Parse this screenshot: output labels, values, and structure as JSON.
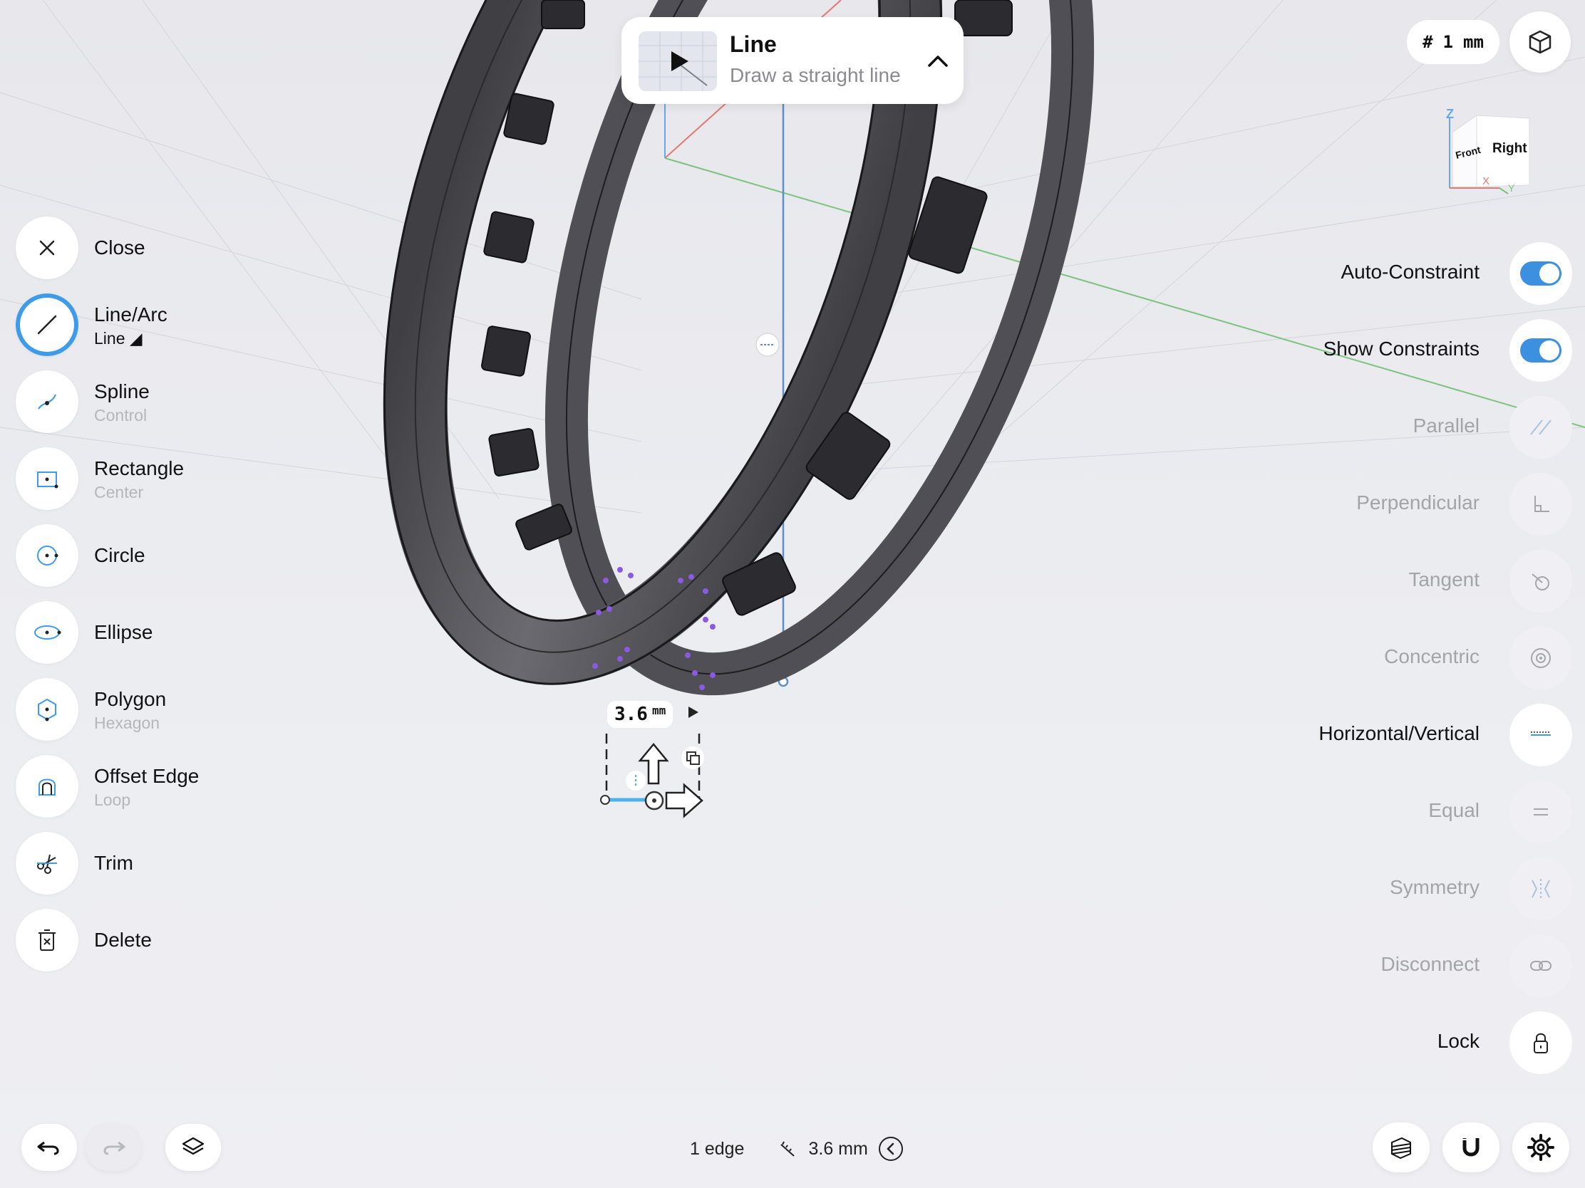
{
  "tool_card": {
    "title": "Line",
    "subtitle": "Draw a straight line"
  },
  "grid": {
    "symbol": "#",
    "value": "1",
    "unit": "mm"
  },
  "view_cube": {
    "top_label": "Z",
    "front_label": "Front",
    "right_label": "Right",
    "x_label": "X",
    "y_label": "Y"
  },
  "left_tools": [
    {
      "label": "Close",
      "sub": ""
    },
    {
      "label": "Line/Arc",
      "sub": "Line ◢"
    },
    {
      "label": "Spline",
      "sub": "Control"
    },
    {
      "label": "Rectangle",
      "sub": "Center"
    },
    {
      "label": "Circle",
      "sub": ""
    },
    {
      "label": "Ellipse",
      "sub": ""
    },
    {
      "label": "Polygon",
      "sub": "Hexagon"
    },
    {
      "label": "Offset Edge",
      "sub": "Loop"
    },
    {
      "label": "Trim",
      "sub": ""
    },
    {
      "label": "Delete",
      "sub": ""
    }
  ],
  "constraints": [
    {
      "label": "Auto-Constraint",
      "state": "on"
    },
    {
      "label": "Show Constraints",
      "state": "on"
    },
    {
      "label": "Parallel",
      "state": "disabled"
    },
    {
      "label": "Perpendicular",
      "state": "disabled"
    },
    {
      "label": "Tangent",
      "state": "disabled"
    },
    {
      "label": "Concentric",
      "state": "disabled"
    },
    {
      "label": "Horizontal/Vertical",
      "state": "enabled"
    },
    {
      "label": "Equal",
      "state": "disabled"
    },
    {
      "label": "Symmetry",
      "state": "disabled"
    },
    {
      "label": "Disconnect",
      "state": "disabled"
    },
    {
      "label": "Lock",
      "state": "enabled"
    }
  ],
  "dimension": {
    "value": "3.6",
    "unit": "mm"
  },
  "status": {
    "selection": "1 edge",
    "length": "3.6 mm"
  },
  "colors": {
    "accent": "#3e9bea",
    "toggle": "#3d8fdf",
    "model": "#56565b",
    "axis_x": "#e07a72",
    "axis_y": "#7cc47e",
    "axis_z": "#6aa7e8"
  }
}
